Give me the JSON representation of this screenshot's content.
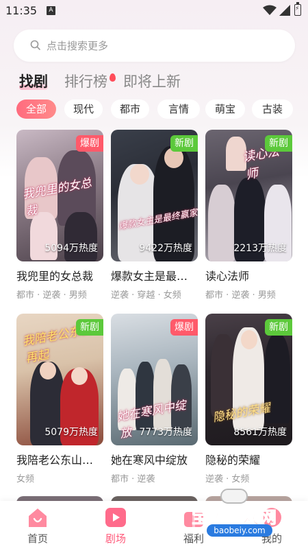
{
  "status_bar": {
    "time": "11:35",
    "notification_icon": "A"
  },
  "search": {
    "placeholder": "点击搜索更多"
  },
  "tabs": [
    {
      "label": "找剧",
      "active": true
    },
    {
      "label": "排行榜",
      "active": false
    },
    {
      "label": "即将上新",
      "active": false
    }
  ],
  "chips": [
    {
      "label": "全部",
      "active": true
    },
    {
      "label": "现代",
      "active": false
    },
    {
      "label": "都市",
      "active": false
    },
    {
      "label": "言情",
      "active": false
    },
    {
      "label": "萌宝",
      "active": false
    },
    {
      "label": "古装",
      "active": false
    }
  ],
  "cards": [
    {
      "title": "我兜里的女总裁",
      "tags": "都市 · 逆袭 · 男频",
      "badge": "爆剧",
      "heat": "5094万热度",
      "cover_text": "我兜里的女总裁"
    },
    {
      "title": "爆款女主是最…",
      "tags": "逆袭 · 穿越 · 女频",
      "badge": "新剧",
      "heat": "9422万热度",
      "cover_text": "爆款女主是最终赢家"
    },
    {
      "title": "读心法师",
      "tags": "都市 · 逆袭 · 男频",
      "badge": "新剧",
      "heat": "2213万热度",
      "cover_text": "读心法师"
    },
    {
      "title": "我陪老公东山…",
      "tags": "女频",
      "badge": "新剧",
      "heat": "5079万热度",
      "cover_text": "我陪老公东山再起"
    },
    {
      "title": "她在寒风中绽放",
      "tags": "都市 · 逆袭",
      "badge": "爆剧",
      "heat": "7773万热度",
      "cover_text": "她在寒风中绽放"
    },
    {
      "title": "隐秘的荣耀",
      "tags": "逆袭 · 女频",
      "badge": "新剧",
      "heat": "8561万热度",
      "cover_text": "隐秘的荣耀"
    }
  ],
  "bottom_nav": [
    {
      "label": "首页",
      "icon": "home-icon",
      "active": false
    },
    {
      "label": "剧场",
      "icon": "theater-icon",
      "active": true
    },
    {
      "label": "福利",
      "icon": "gift-icon",
      "active": false
    },
    {
      "label": "我的",
      "icon": "profile-icon",
      "active": false
    }
  ],
  "watermark": {
    "text": "宝贝游戏网",
    "url": "baobeiy.com"
  },
  "colors": {
    "accent": "#ff5a6a",
    "new_badge": "#5cc93b",
    "active_nav": "#ff5a7a"
  }
}
